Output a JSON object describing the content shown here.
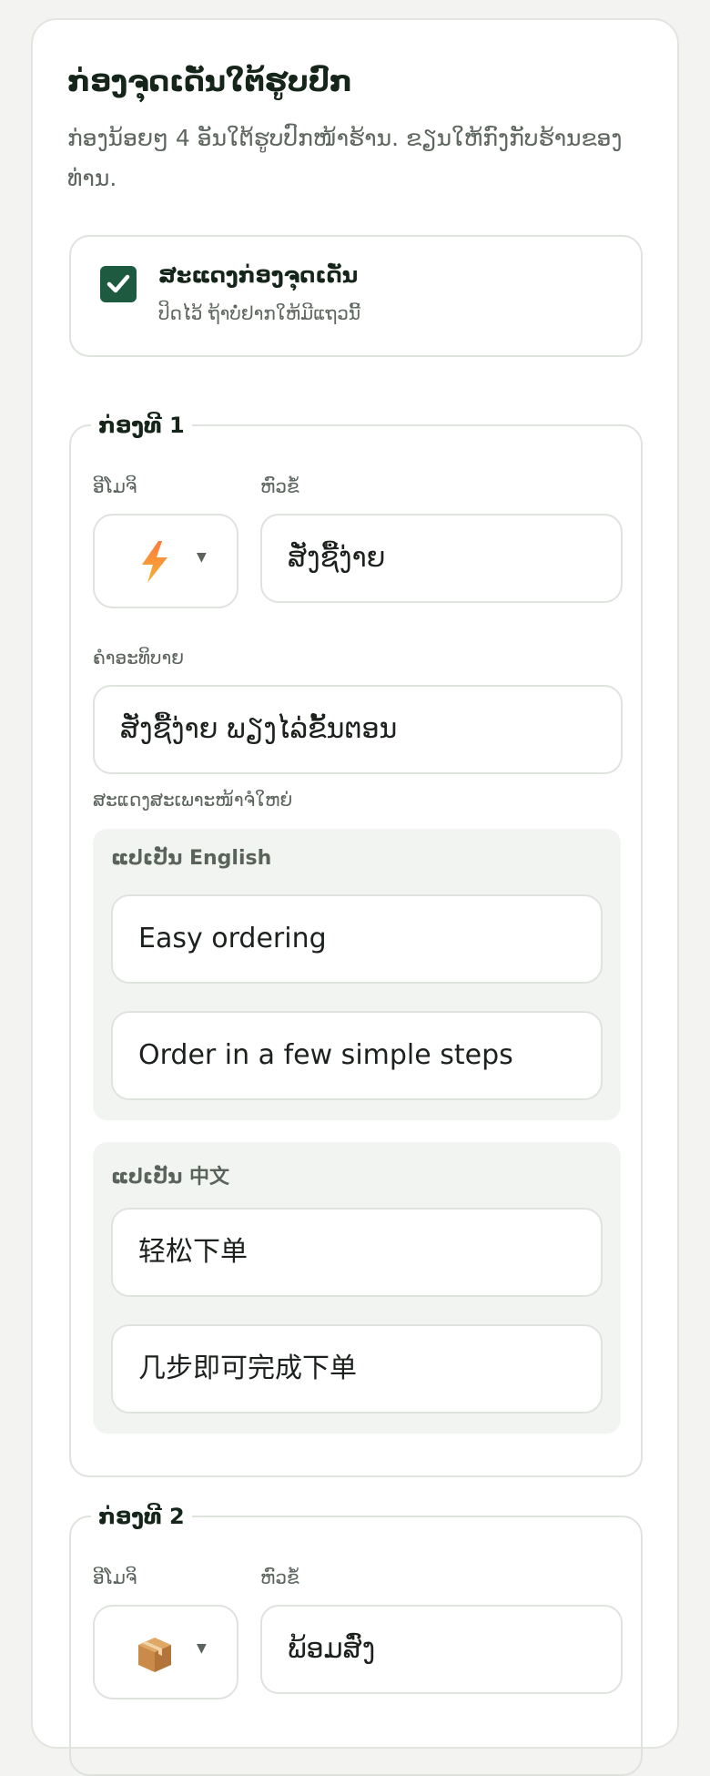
{
  "section": {
    "title": "ກ່ອງຈຸດເດັ່ນໃຕ້ຮູບປົກ",
    "subtitle": "ກ່ອງນ້ອຍໆ 4 ອັນໃຕ້ຮູບປົກໜ້າຮ້ານ. ຂຽນໃຫ້ກົງກັບຮ້ານຂອງທ່ານ."
  },
  "toggle": {
    "label": "ສະແດງກ່ອງຈຸດເດັ່ນ",
    "hint": "ປິດໄວ້ ຖ້າບໍ່ຢາກໃຫ້ມີແຖວນີ້",
    "checked": true
  },
  "labels": {
    "emoji": "ອີໂມຈິ",
    "title": "ຫົວຂໍ້",
    "description": "ຄຳອະທິບາຍ",
    "desktop_only": "ສະແດງສະເພາະໜ້າຈໍໃຫຍ່"
  },
  "boxes": [
    {
      "legend": "ກ່ອງທີ 1",
      "emoji": "lightning-icon",
      "title": "ສັ່ງຊື້ງ່າຍ",
      "description": "ສັ່ງຊື້ງ່າຍ ພຽງໄລ່ຂັ້ນຕອນ",
      "translations": [
        {
          "label": "ແປເປັນ English",
          "title": "Easy ordering",
          "description": "Order in a few simple steps"
        },
        {
          "label": "ແປເປັນ 中文",
          "title": "轻松下单",
          "description": "几步即可完成下单"
        }
      ]
    },
    {
      "legend": "ກ່ອງທີ 2",
      "emoji": "package-icon",
      "title": "ພ້ອມສົ່ງ"
    }
  ],
  "colors": {
    "accent": "#1d5a40",
    "border": "#dfe3de",
    "translation_bg": "#f2f4f1"
  }
}
